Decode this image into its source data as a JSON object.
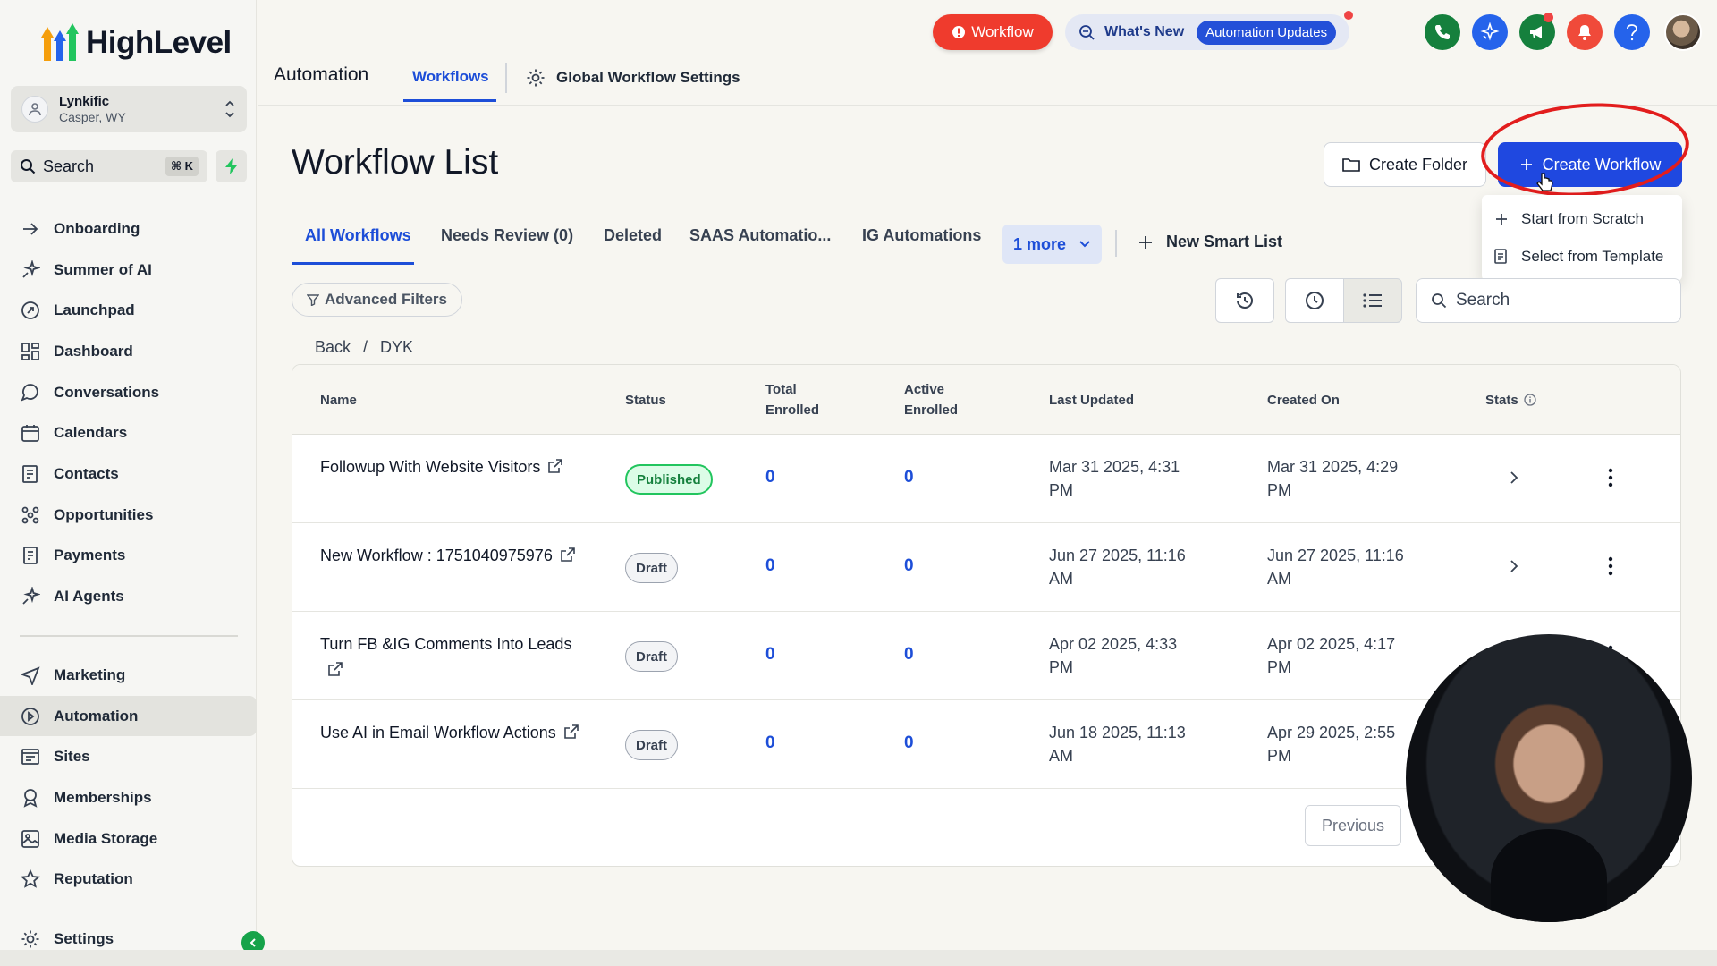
{
  "brand": {
    "name": "HighLevel"
  },
  "account": {
    "name": "Lynkific",
    "location": "Casper, WY"
  },
  "sidebar": {
    "search_label": "Search",
    "search_shortcut": "⌘ K",
    "items": [
      {
        "label": "Onboarding",
        "icon": "arrow-right-icon"
      },
      {
        "label": "Summer of AI",
        "icon": "sparkle-icon"
      },
      {
        "label": "Launchpad",
        "icon": "rocket-icon"
      },
      {
        "label": "Dashboard",
        "icon": "grid-icon"
      },
      {
        "label": "Conversations",
        "icon": "chat-icon"
      },
      {
        "label": "Calendars",
        "icon": "calendar-icon"
      },
      {
        "label": "Contacts",
        "icon": "contacts-icon"
      },
      {
        "label": "Opportunities",
        "icon": "opportunities-icon"
      },
      {
        "label": "Payments",
        "icon": "payments-icon"
      },
      {
        "label": "AI Agents",
        "icon": "sparkle-icon"
      }
    ],
    "items2": [
      {
        "label": "Marketing",
        "icon": "send-icon"
      },
      {
        "label": "Automation",
        "icon": "automation-icon",
        "active": true
      },
      {
        "label": "Sites",
        "icon": "sites-icon"
      },
      {
        "label": "Memberships",
        "icon": "award-icon"
      },
      {
        "label": "Media Storage",
        "icon": "image-icon"
      },
      {
        "label": "Reputation",
        "icon": "star-icon"
      }
    ],
    "settings_label": "Settings"
  },
  "header": {
    "title": "Automation",
    "tab_workflows": "Workflows",
    "global_settings": "Global Workflow Settings",
    "pill_workflow": "Workflow",
    "whats_new": "What's New",
    "automation_updates": "Automation Updates"
  },
  "main": {
    "page_title": "Workflow List",
    "create_folder": "Create Folder",
    "create_workflow": "Create Workflow",
    "dropdown": {
      "start_from_scratch": "Start from Scratch",
      "select_from_template": "Select from Template"
    },
    "tabs": {
      "all": "All Workflows",
      "needs_review": "Needs Review (0)",
      "deleted": "Deleted",
      "saas": "SAAS Automatio...",
      "ig": "IG Automations",
      "more": "1 more",
      "new_smart_list": "New Smart List"
    },
    "advanced_filters": "Advanced Filters",
    "search_placeholder": "Search",
    "breadcrumb": {
      "back": "Back",
      "sep": "/",
      "current": "DYK"
    },
    "table": {
      "headers": {
        "name": "Name",
        "status": "Status",
        "total_enrolled_1": "Total",
        "total_enrolled_2": "Enrolled",
        "active_enrolled_1": "Active",
        "active_enrolled_2": "Enrolled",
        "last_updated": "Last Updated",
        "created_on": "Created On",
        "stats": "Stats"
      },
      "rows": [
        {
          "name": "Followup With Website Visitors",
          "status": "Published",
          "total": "0",
          "active": "0",
          "updated_1": "Mar 31 2025, 4:31",
          "updated_2": "PM",
          "created_1": "Mar 31 2025, 4:29",
          "created_2": "PM"
        },
        {
          "name": "New Workflow : 1751040975976",
          "status": "Draft",
          "total": "0",
          "active": "0",
          "updated_1": "Jun 27 2025, 11:16",
          "updated_2": "AM",
          "created_1": "Jun 27 2025, 11:16",
          "created_2": "AM"
        },
        {
          "name": "Turn FB &IG Comments Into Leads",
          "status": "Draft",
          "total": "0",
          "active": "0",
          "updated_1": "Apr 02 2025, 4:33",
          "updated_2": "PM",
          "created_1": "Apr 02 2025, 4:17",
          "created_2": "PM"
        },
        {
          "name": "Use AI in Email Workflow Actions",
          "status": "Draft",
          "total": "0",
          "active": "0",
          "updated_1": "Jun 18 2025, 11:13",
          "updated_2": "AM",
          "created_1": "Apr 29 2025, 2:55",
          "created_2": "PM"
        }
      ]
    },
    "previous": "Previous"
  },
  "colors": {
    "primary": "#1f48e0",
    "accent_red": "#ef3b2d",
    "success": "#22c55e",
    "tab_active": "#1d4ed8"
  }
}
